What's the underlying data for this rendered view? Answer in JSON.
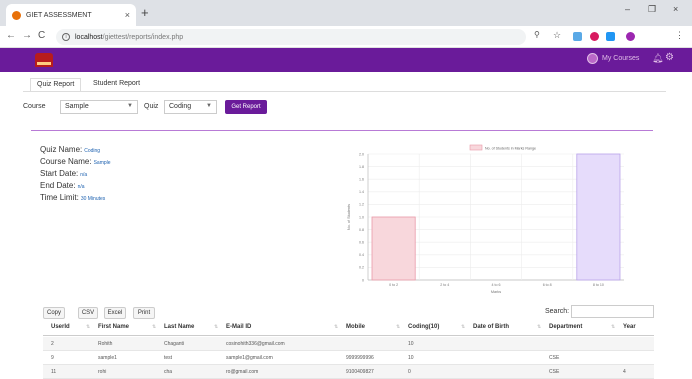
{
  "browser": {
    "tab_title": "GIET ASSESSMENT",
    "tab_close": "×",
    "new_tab": "+",
    "url_host": "localhost",
    "url_path": "/giettest/reports/index.php",
    "minimize": "–",
    "restore": "❐",
    "close": "×"
  },
  "navbar": {
    "user_label": "My Courses",
    "brand_color": "#6a1b9a"
  },
  "tabs": [
    {
      "label": "Quiz Report",
      "active": true
    },
    {
      "label": "Student Report",
      "active": false
    }
  ],
  "filters": {
    "course_label": "Course",
    "course_value": "Sample",
    "quiz_label": "Quiz",
    "quiz_value": "Coding",
    "button_label": "Get Report"
  },
  "quiz_info": {
    "name_label": "Quiz Name:",
    "name_value": "Coding",
    "course_label": "Course Name:",
    "course_value": "Sample",
    "start_label": "Start Date:",
    "start_value": "n/a",
    "end_label": "End Date:",
    "end_value": "n/a",
    "time_label": "Time Limit:",
    "time_value": "30 Minutes"
  },
  "chart_data": {
    "type": "bar",
    "legend": "No. of Students in Marks Range",
    "categories": [
      "0 to 2",
      "2 to 4",
      "4 to 6",
      "6 to 8",
      "8 to 10"
    ],
    "values": [
      1,
      0,
      0,
      0,
      2
    ],
    "bar_colors": [
      "#f8d7dc",
      "#dcd0f5",
      "#dcd0f5",
      "#dcd0f5",
      "#e6dcfb"
    ],
    "bar_borders": [
      "#e99aa8",
      "#b9a3ea",
      "#b9a3ea",
      "#b9a3ea",
      "#b9a3ea"
    ],
    "ylabel": "No. of Students",
    "xlabel": "Marks",
    "ylim": [
      0,
      2.0
    ],
    "yticks": [
      "0",
      "0.2",
      "0.4",
      "0.6",
      "0.8",
      "1.0",
      "1.2",
      "1.4",
      "1.6",
      "1.8",
      "2.0"
    ]
  },
  "table_controls": {
    "copy": "Copy",
    "csv": "CSV",
    "excel": "Excel",
    "print": "Print",
    "search_label": "Search:"
  },
  "table": {
    "headers": [
      "UserId",
      "First Name",
      "Last Name",
      "E-Mail ID",
      "Mobile",
      "Coding(10)",
      "Date of Birth",
      "Department",
      "Year"
    ],
    "rows": [
      [
        "2",
        "Rohith",
        "Chaganti",
        "cosinohith336@gmail.com",
        "",
        "10",
        "",
        "",
        ""
      ],
      [
        "9",
        "sample1",
        "test",
        "sample1@gmail.com",
        "9999999996",
        "10",
        "",
        "CSE",
        ""
      ],
      [
        "11",
        "rohi",
        "cha",
        "ro@gmail.com",
        "9100409827",
        "0",
        "",
        "CSE",
        "4"
      ]
    ]
  }
}
